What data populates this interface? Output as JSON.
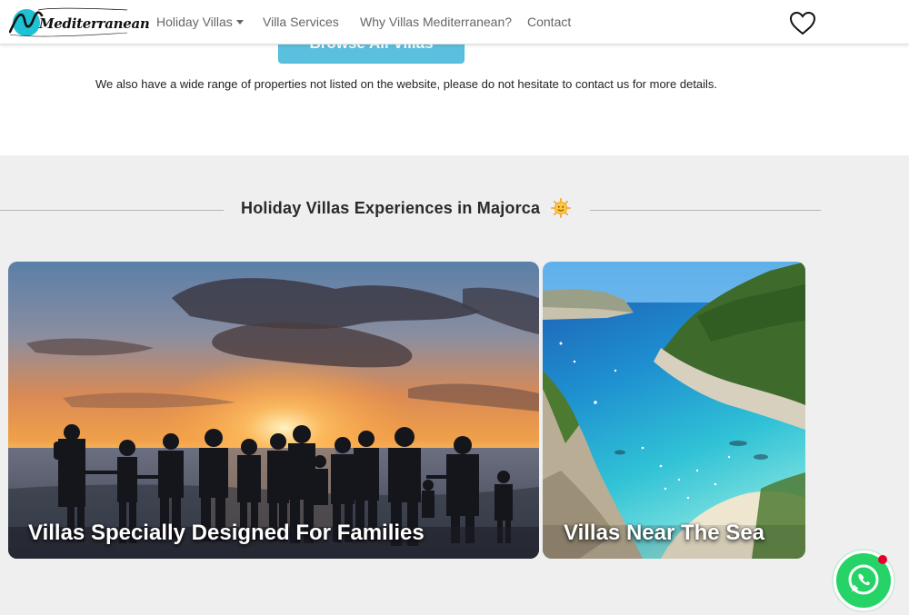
{
  "navbar": {
    "logo_text": "Mediterranean",
    "items": [
      {
        "label": "Holiday Villas",
        "has_dropdown": true
      },
      {
        "label": "Villa Services"
      },
      {
        "label": "Why Villas Mediterranean?"
      },
      {
        "label": "Contact"
      }
    ],
    "favorites_icon": "heart-outline-icon"
  },
  "top": {
    "browse_button": "Browse All Villas",
    "notice": "We also have a wide range of properties not listed on the website, please do not hesitate to contact us for more details."
  },
  "experiences": {
    "title": "Holiday Villas Experiences in Majorca",
    "title_icon": "smiling-sun-emoji",
    "cards": [
      {
        "title": "Villas Specially Designed For Families",
        "image": "families-at-beach-sunset"
      },
      {
        "title": "Villas Near The Sea",
        "image": "turquoise-cove"
      }
    ]
  },
  "whatsapp": {
    "icon": "whatsapp-icon",
    "notification_color": "#e4002b"
  },
  "colors": {
    "accent": "#5bc0de",
    "whatsapp": "#25d366",
    "section_bg": "#efefef"
  }
}
